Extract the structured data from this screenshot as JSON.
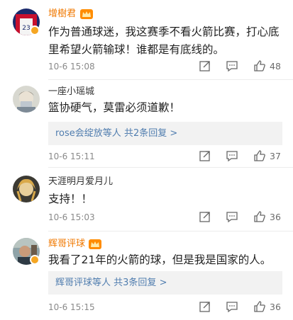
{
  "comments": [
    {
      "name": "增樹君",
      "vip": true,
      "text_lines": [
        "作为普通球迷，我这赛季不看火箭比赛，打心底",
        "里希望火箭输球！谁都是有底线的。"
      ],
      "time": "10-6 15:08",
      "likes": "48"
    },
    {
      "name": "一座小瑶城",
      "vip": false,
      "text_lines": [
        "篮协硬气，莫雷必须道歉！"
      ],
      "reply_users": "rose会绽放等人",
      "reply_count": "共2条回复",
      "time": "10-6 15:11",
      "likes": "37"
    },
    {
      "name": "天涯明月爱月儿",
      "vip": false,
      "text_lines": [
        "支持！！"
      ],
      "time": "10-6 15:03",
      "likes": "36"
    },
    {
      "name": "辉哥评球",
      "vip": true,
      "text_lines": [
        "我看了21年的火箭的球，但是我是国家的人。"
      ],
      "reply_users": "辉哥评球等人",
      "reply_count": "共3条回复",
      "time": "10-6 15:15",
      "likes": "36"
    }
  ],
  "reply_arrow": ">",
  "icons": [
    "share-icon",
    "comment-icon",
    "like-icon"
  ],
  "colors": {
    "vip_name": "#f07800",
    "reply_link": "#507daf",
    "meta": "#8a8a8a"
  }
}
